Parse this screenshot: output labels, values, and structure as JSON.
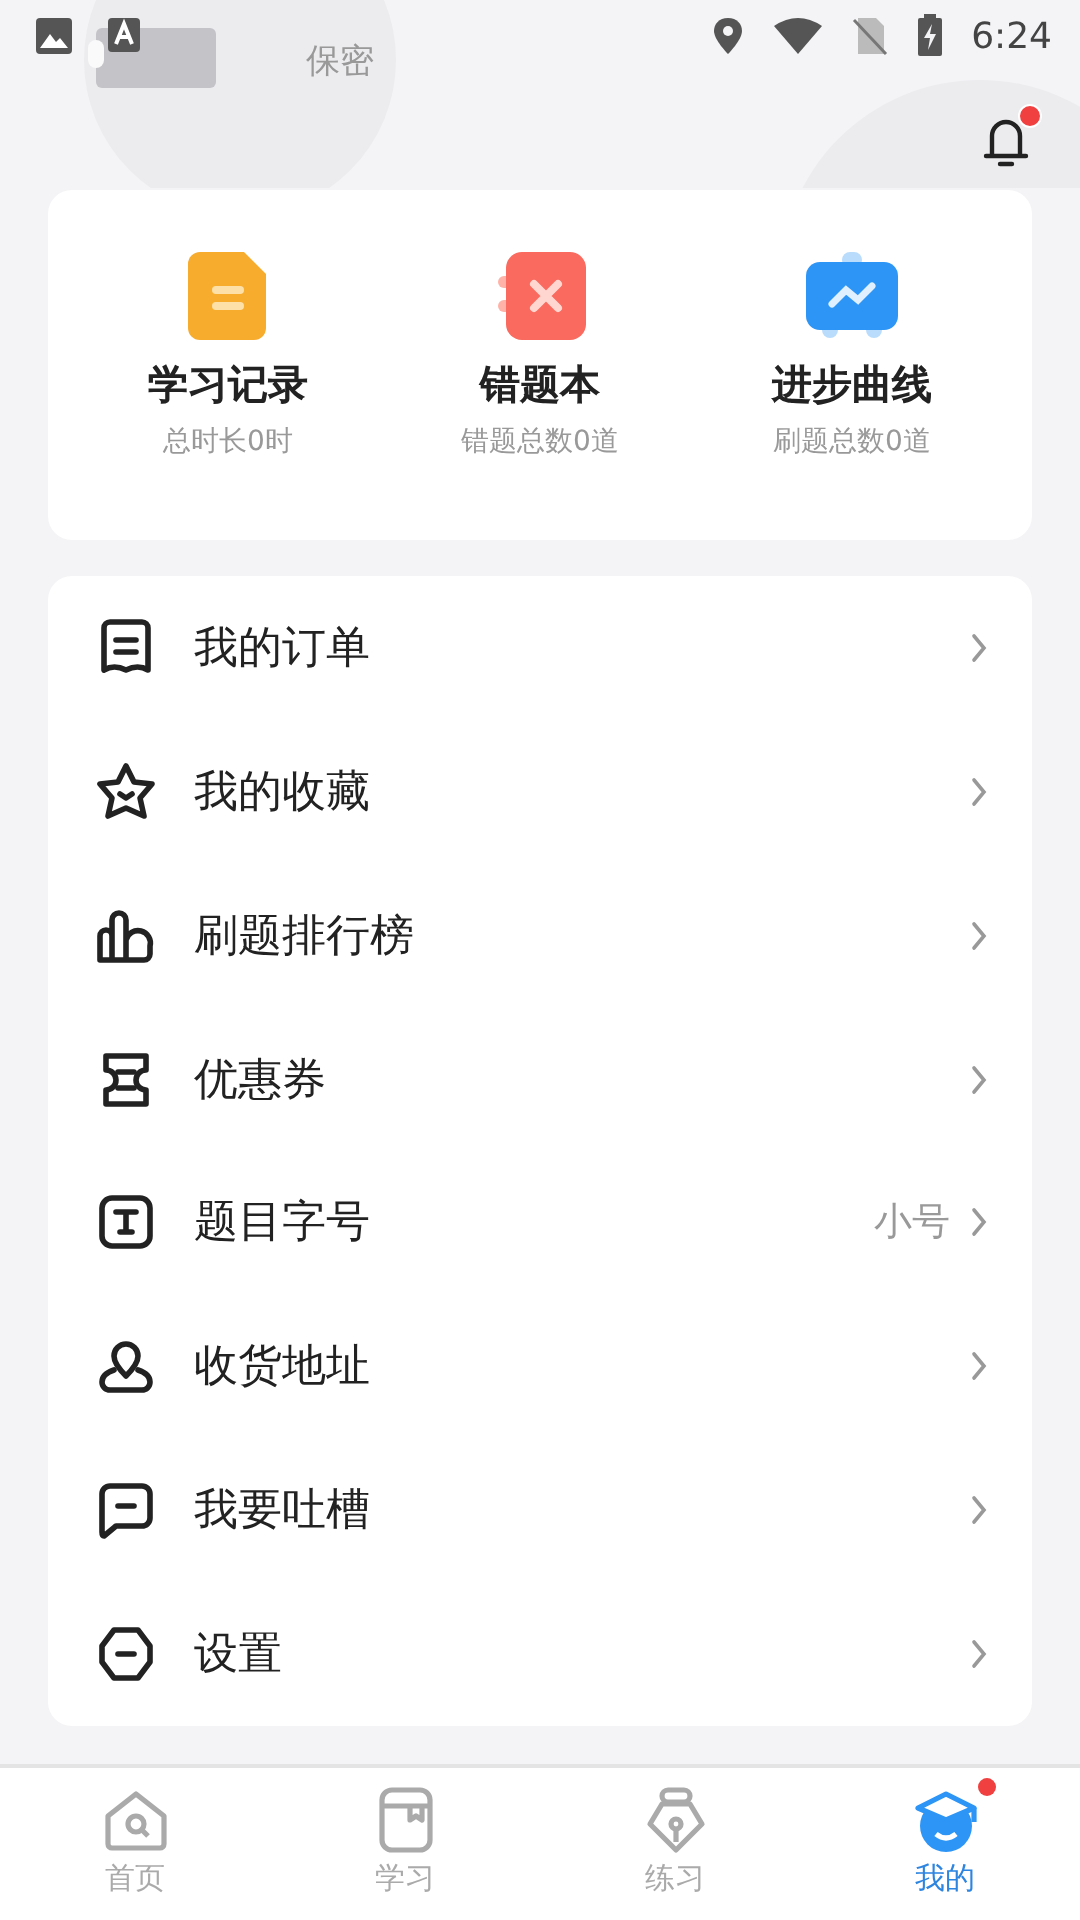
{
  "status_bar": {
    "time": "6:24"
  },
  "profile": {
    "privacy": "保密",
    "notification_dot": true
  },
  "stats": [
    {
      "kind": "record",
      "title": "学习记录",
      "subtitle": "总时长0时"
    },
    {
      "kind": "mistakes",
      "title": "错题本",
      "subtitle": "错题总数0道"
    },
    {
      "kind": "progress",
      "title": "进步曲线",
      "subtitle": "刷题总数0道"
    }
  ],
  "menu": [
    {
      "kind": "order",
      "label": "我的订单"
    },
    {
      "kind": "favorite",
      "label": "我的收藏"
    },
    {
      "kind": "ranking",
      "label": "刷题排行榜"
    },
    {
      "kind": "coupon",
      "label": "优惠券"
    },
    {
      "kind": "font",
      "label": "题目字号",
      "value": "小号"
    },
    {
      "kind": "address",
      "label": "收货地址"
    },
    {
      "kind": "feedback",
      "label": "我要吐槽"
    },
    {
      "kind": "settings",
      "label": "设置"
    }
  ],
  "tab_bar": [
    {
      "kind": "home",
      "label": "首页",
      "selected": false,
      "dot": false
    },
    {
      "kind": "study",
      "label": "学习",
      "selected": false,
      "dot": false
    },
    {
      "kind": "practice",
      "label": "练习",
      "selected": false,
      "dot": false
    },
    {
      "kind": "me",
      "label": "我的",
      "selected": true,
      "dot": true
    }
  ]
}
